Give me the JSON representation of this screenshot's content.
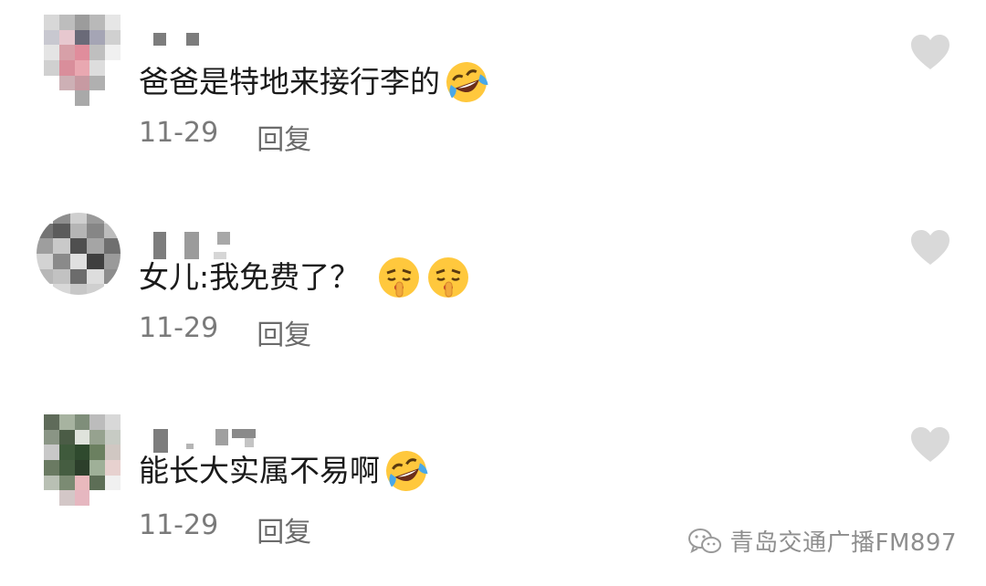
{
  "comments": [
    {
      "text": "爸爸是特地来接行李的",
      "emoji": "rofl-emoji",
      "date": "11-29",
      "reply_label": "回复"
    },
    {
      "text": "女儿:我免费了？",
      "emoji": "shushing-face-emoji",
      "date": "11-29",
      "reply_label": "回复"
    },
    {
      "text": "能长大实属不易啊",
      "emoji": "rofl-emoji",
      "date": "11-29",
      "reply_label": "回复"
    }
  ],
  "watermark": {
    "text": "青岛交通广播FM897",
    "icon": "wechat-icon"
  },
  "colors": {
    "text": "#1a1a1a",
    "meta": "#7a7a7a",
    "heart": "#d9d9d9",
    "background": "#ffffff"
  }
}
